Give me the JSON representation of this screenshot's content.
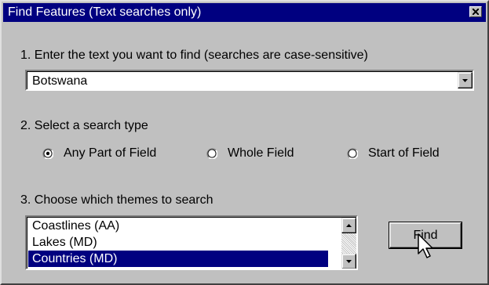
{
  "window": {
    "title": "Find Features (Text searches only)"
  },
  "step1": {
    "label": "1. Enter the text you want to find (searches are case-sensitive)",
    "value": "Botswana"
  },
  "step2": {
    "label": "2. Select a search type",
    "options": [
      {
        "label": "Any Part of Field",
        "selected": true
      },
      {
        "label": "Whole Field",
        "selected": false
      },
      {
        "label": "Start of Field",
        "selected": false
      }
    ]
  },
  "step3": {
    "label": "3. Choose which themes to search",
    "themes": [
      {
        "label": "Coastlines (AA)",
        "selected": false
      },
      {
        "label": "Lakes (MD)",
        "selected": false
      },
      {
        "label": "Countries (MD)",
        "selected": true
      }
    ]
  },
  "buttons": {
    "find_label": "Find"
  },
  "icons": {
    "close": "close-icon",
    "dropdown": "chevron-down-icon",
    "scroll_up": "arrow-up-icon",
    "scroll_down": "arrow-down-icon",
    "cursor": "mouse-pointer-icon"
  },
  "colors": {
    "titlebar": "#000080",
    "selection": "#000080",
    "face": "#c0c0c0"
  }
}
